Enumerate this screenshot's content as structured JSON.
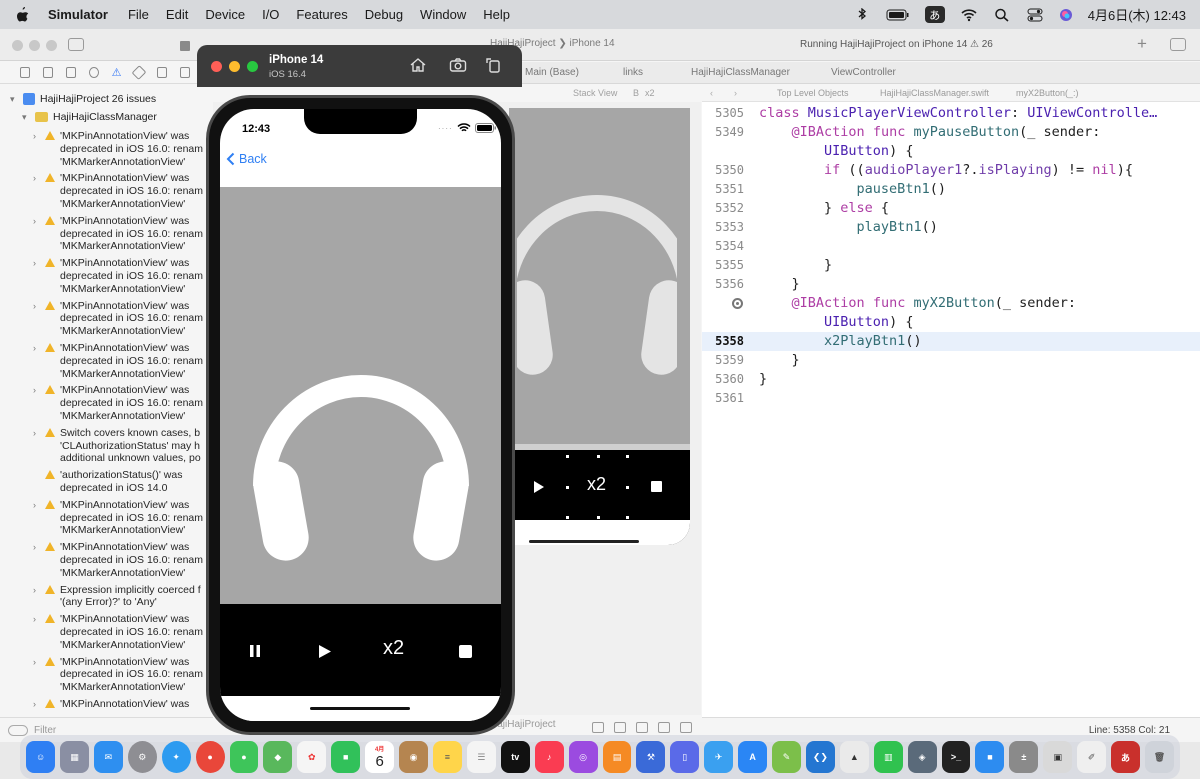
{
  "menubar": {
    "app_name": "Simulator",
    "items": [
      "File",
      "Edit",
      "Device",
      "I/O",
      "Features",
      "Debug",
      "Window",
      "Help"
    ],
    "input_method": "あ",
    "clock": "4月6日(木) 12:43"
  },
  "xcode": {
    "window_title": "HajiHajiProject",
    "scheme": "HajiHajiProject ❯ iPhone 14",
    "run_status": "Running HajiHajiProject on iPhone 14",
    "issue_count": "26",
    "tabs": [
      "Main (Base)",
      "links",
      "HajiHajiClassManager",
      "ViewController"
    ],
    "jump_bar_canvas": [
      "Stack View",
      "B",
      "x2"
    ],
    "jump_bar_code": [
      "Top Level Objects",
      "HajiHajiClassManager.swift",
      "myX2Button(_:)"
    ],
    "cursor_position": "Line: 5358  Col: 21",
    "canvas_footer": "HajiHajiProject",
    "filter_placeholder": "Filter"
  },
  "navigator": {
    "project_label": "HajiHajiProject 26 issues",
    "group_label": "HajiHajiClassManager",
    "issues": [
      {
        "text": [
          "'MKPinAnnotationView' was",
          "deprecated in iOS 16.0: renam",
          "'MKMarkerAnnotationView'"
        ],
        "expandable": true
      },
      {
        "text": [
          "'MKPinAnnotationView' was",
          "deprecated in iOS 16.0: renam",
          "'MKMarkerAnnotationView'"
        ],
        "expandable": true
      },
      {
        "text": [
          "'MKPinAnnotationView' was",
          "deprecated in iOS 16.0: renam",
          "'MKMarkerAnnotationView'"
        ],
        "expandable": true
      },
      {
        "text": [
          "'MKPinAnnotationView' was",
          "deprecated in iOS 16.0: renam",
          "'MKMarkerAnnotationView'"
        ],
        "expandable": true
      },
      {
        "text": [
          "'MKPinAnnotationView' was",
          "deprecated in iOS 16.0: renam",
          "'MKMarkerAnnotationView'"
        ],
        "expandable": true
      },
      {
        "text": [
          "'MKPinAnnotationView' was",
          "deprecated in iOS 16.0: renam",
          "'MKMarkerAnnotationView'"
        ],
        "expandable": true
      },
      {
        "text": [
          "'MKPinAnnotationView' was",
          "deprecated in iOS 16.0: renam",
          "'MKMarkerAnnotationView'"
        ],
        "expandable": true
      },
      {
        "text": [
          "Switch covers known cases, b",
          "'CLAuthorizationStatus' may h",
          "additional unknown values, po"
        ],
        "expandable": true
      },
      {
        "text": [
          "'authorizationStatus()' was",
          "deprecated in iOS 14.0"
        ],
        "expandable": false
      },
      {
        "text": [
          "'MKPinAnnotationView' was",
          "deprecated in iOS 16.0: renam",
          "'MKMarkerAnnotationView'"
        ],
        "expandable": true
      },
      {
        "text": [
          "'MKPinAnnotationView' was",
          "deprecated in iOS 16.0: renam",
          "'MKMarkerAnnotationView'"
        ],
        "expandable": true
      },
      {
        "text": [
          "Expression implicitly coerced f",
          "'(any Error)?' to 'Any'"
        ],
        "expandable": true
      },
      {
        "text": [
          "'MKPinAnnotationView' was",
          "deprecated in iOS 16.0: renam",
          "'MKMarkerAnnotationView'"
        ],
        "expandable": true
      },
      {
        "text": [
          "'MKPinAnnotationView' was",
          "deprecated in iOS 16.0: renam",
          "'MKMarkerAnnotationView'"
        ],
        "expandable": true
      },
      {
        "text": [
          "'MKPinAnnotationView' was"
        ],
        "expandable": true
      }
    ]
  },
  "code": {
    "lines": [
      {
        "num": "5305",
        "tokens": [
          [
            "kw",
            "class "
          ],
          [
            "ty",
            "MusicPlayerViewController"
          ],
          [
            "pl",
            ": "
          ],
          [
            "ty",
            "UIViewControlle…"
          ]
        ]
      },
      {
        "num": "5349",
        "tokens": [
          [
            "pl",
            "    "
          ],
          [
            "at",
            "@IBAction"
          ],
          [
            "pl",
            " "
          ],
          [
            "kw",
            "func"
          ],
          [
            "pl",
            " "
          ],
          [
            "fn",
            "myPauseButton"
          ],
          [
            "pl",
            "(_ sender:"
          ]
        ]
      },
      {
        "num": "",
        "tokens": [
          [
            "pl",
            "        "
          ],
          [
            "ty",
            "UIButton"
          ],
          [
            "pl",
            ") {"
          ]
        ]
      },
      {
        "num": "5350",
        "tokens": [
          [
            "pl",
            "        "
          ],
          [
            "kw",
            "if"
          ],
          [
            "pl",
            " (("
          ],
          [
            "ac",
            "audioPlayer1"
          ],
          [
            "pl",
            "?."
          ],
          [
            "ac",
            "isPlaying"
          ],
          [
            "pl",
            ") != "
          ],
          [
            "kw",
            "nil"
          ],
          [
            "pl",
            "){"
          ]
        ]
      },
      {
        "num": "5351",
        "tokens": [
          [
            "pl",
            "            "
          ],
          [
            "fn",
            "pauseBtn1"
          ],
          [
            "pl",
            "()"
          ]
        ]
      },
      {
        "num": "5352",
        "tokens": [
          [
            "pl",
            "        } "
          ],
          [
            "kw",
            "else"
          ],
          [
            "pl",
            " {"
          ]
        ]
      },
      {
        "num": "5353",
        "tokens": [
          [
            "pl",
            "            "
          ],
          [
            "fn",
            "playBtn1"
          ],
          [
            "pl",
            "()"
          ]
        ]
      },
      {
        "num": "5354",
        "tokens": [
          [
            "pl",
            ""
          ]
        ]
      },
      {
        "num": "5355",
        "tokens": [
          [
            "pl",
            "        }"
          ]
        ]
      },
      {
        "num": "5356",
        "tokens": [
          [
            "pl",
            "    }"
          ]
        ]
      },
      {
        "num": "",
        "tokens": [
          [
            "pl",
            "    "
          ],
          [
            "at",
            "@IBAction"
          ],
          [
            "pl",
            " "
          ],
          [
            "kw",
            "func"
          ],
          [
            "pl",
            " "
          ],
          [
            "fn",
            "myX2Button"
          ],
          [
            "pl",
            "(_ sender:"
          ]
        ]
      },
      {
        "num": "",
        "tokens": [
          [
            "pl",
            "        "
          ],
          [
            "ty",
            "UIButton"
          ],
          [
            "pl",
            ") {"
          ]
        ]
      },
      {
        "num": "5358",
        "tokens": [
          [
            "pl",
            "        "
          ],
          [
            "fn",
            "x2PlayBtn1"
          ],
          [
            "pl",
            "()"
          ]
        ]
      },
      {
        "num": "5359",
        "tokens": [
          [
            "pl",
            "    }"
          ]
        ]
      },
      {
        "num": "5360",
        "tokens": [
          [
            "pl",
            "}"
          ]
        ]
      },
      {
        "num": "5361",
        "tokens": [
          [
            "pl",
            ""
          ]
        ]
      }
    ],
    "current_line_index": 12,
    "breakpoint_line_index": 10
  },
  "simulator": {
    "device_name": "iPhone 14",
    "os_version": "iOS 16.4",
    "time": "12:43",
    "back_label": "Back",
    "x2_label": "x2"
  },
  "storyboard": {
    "x2_label": "x2"
  },
  "dock": {
    "calendar_month": "4月",
    "calendar_day": "6"
  }
}
